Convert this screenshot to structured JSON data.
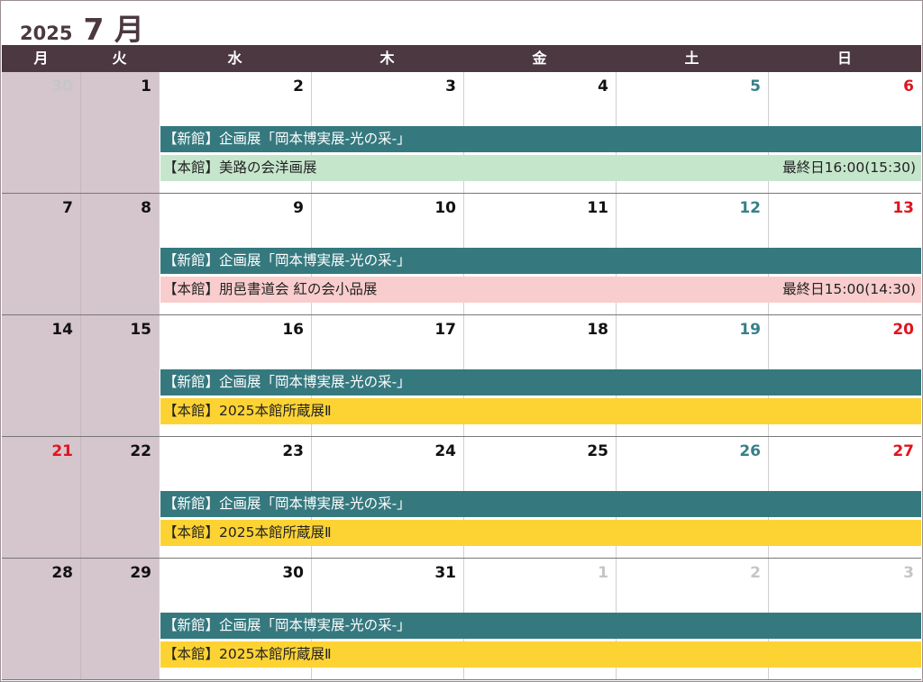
{
  "header": {
    "year": "2025",
    "month": "7 月"
  },
  "weekdays": [
    "月",
    "火",
    "水",
    "木",
    "金",
    "土",
    "日"
  ],
  "colors": {
    "header_bg": "#4b3840",
    "weekend_col_bg": "#d5c5cc",
    "new_wing_bar": "#35797f",
    "main_bar_green": "#c6e6cc",
    "main_bar_pink": "#f9cdcd",
    "main_bar_yellow": "#fdd334",
    "saturday_text": "#37808a",
    "sunday_text": "#e0141e"
  },
  "weeks": [
    {
      "days": [
        "30",
        "1",
        "2",
        "3",
        "4",
        "5",
        "6"
      ],
      "new_event": "【新館】企画展「岡本博実展-光の采-」",
      "main_event": "【本館】美路の会洋画展",
      "main_end": "最終日16:00(15:30)",
      "main_color": "#c6e6cc"
    },
    {
      "days": [
        "7",
        "8",
        "9",
        "10",
        "11",
        "12",
        "13"
      ],
      "new_event": "【新館】企画展「岡本博実展-光の采-」",
      "main_event": "【本館】朋邑書道会 紅の会小品展",
      "main_end": "最終日15:00(14:30)",
      "main_color": "#f9cdcd"
    },
    {
      "days": [
        "14",
        "15",
        "16",
        "17",
        "18",
        "19",
        "20"
      ],
      "new_event": "【新館】企画展「岡本博実展-光の采-」",
      "main_event": "【本館】2025本館所蔵展Ⅱ",
      "main_end": "",
      "main_color": "#fdd334"
    },
    {
      "days": [
        "21",
        "22",
        "23",
        "24",
        "25",
        "26",
        "27"
      ],
      "new_event": "【新館】企画展「岡本博実展-光の采-」",
      "main_event": "【本館】2025本館所蔵展Ⅱ",
      "main_end": "",
      "main_color": "#fdd334"
    },
    {
      "days": [
        "28",
        "29",
        "30",
        "31",
        "1",
        "2",
        "3"
      ],
      "new_event": "【新館】企画展「岡本博実展-光の采-」",
      "main_event": "【本館】2025本館所蔵展Ⅱ",
      "main_end": "",
      "main_color": "#fdd334"
    }
  ]
}
